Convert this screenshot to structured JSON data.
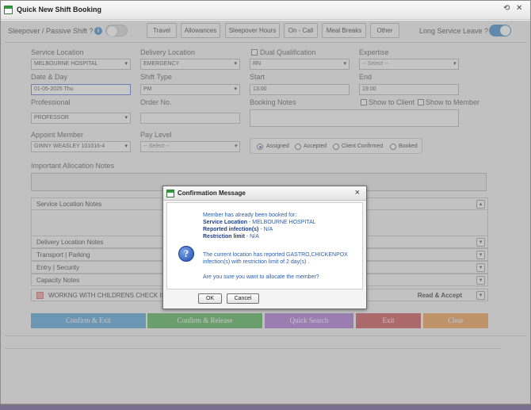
{
  "window": {
    "title": "Quick New Shift Booking"
  },
  "top_bar": {
    "sleepover_label": "Sleepover / Passive Shift ?",
    "tabs": [
      "Travel",
      "Allowances",
      "Sleepover Hours",
      "On - Call",
      "Meal Breaks",
      "Other"
    ],
    "long_service_label": "Long Service Leave ?",
    "sleepover_on": false,
    "long_service_on": true
  },
  "form": {
    "service_location": {
      "label": "Service Location",
      "value": "MELBOURNE HOSPITAL"
    },
    "delivery_location": {
      "label": "Delivery Location",
      "value": "EMERGENCY"
    },
    "dual_qualification": {
      "label": "Dual Qualification",
      "value": "RN"
    },
    "expertise": {
      "label": "Expertise",
      "placeholder": "-- Select --"
    },
    "date_day": {
      "label": "Date & Day",
      "value": "01-05-2025 Thu"
    },
    "shift_type": {
      "label": "Shift Type",
      "value": "PM"
    },
    "start": {
      "label": "Start",
      "value": "13:00"
    },
    "end": {
      "label": "End",
      "value": "19:00"
    },
    "professional": {
      "label": "Professional",
      "value": "PROFESSOR"
    },
    "order_no": {
      "label": "Order No.",
      "value": ""
    },
    "booking_notes": {
      "label": "Booking Notes"
    },
    "show_to_client": "Show to Client",
    "show_to_member": "Show to Member",
    "appoint_member": {
      "label": "Appoint Member",
      "value": "GINNY WEASLEY 101016-4"
    },
    "pay_level": {
      "label": "Pay Level",
      "placeholder": "-- Select --"
    },
    "status_options": [
      "Assigned",
      "Accepted",
      "Client Confirmed",
      "Booked"
    ],
    "status_selected": "Assigned",
    "allocation_notes_label": "Important Allocation Notes"
  },
  "sections": {
    "service_location_notes": "Service Location Notes",
    "delivery_location_notes": "Delivery Location Notes",
    "transport_parking": "Transport | Parking",
    "entry_security": "Entry | Security",
    "capacity_notes": "Capacity Notes",
    "wwc_label": "WORKNG WITH CHILDRENS CHECK IS F",
    "read_accept": "Read & Accept"
  },
  "actions": {
    "confirm_exit": "Confirm & Exit",
    "confirm_release": "Confirm & Release",
    "quick_search": "Quick Search",
    "exit": "Exit",
    "clear": "Clear"
  },
  "colors": {
    "confirm_exit": "#4d9fd8",
    "confirm_release": "#4caf50",
    "quick_search": "#a86fd3",
    "exit": "#c9494e",
    "clear": "#eb9a49",
    "toggle_on": "#3a86c8"
  },
  "dialog": {
    "title": "Confirmation Message",
    "line1": "Member has already been booked for:",
    "service_location_key": "Service Location",
    "service_location_val": " - MELBOURNE HOSPITAL",
    "reported_key": "Reported infection(s)",
    "reported_val": " - N/A",
    "restriction_key": "Restriction limit",
    "restriction_val": " - N/A",
    "current_line1": "The current location has reported GASTRO,CHICKENPOX",
    "current_line2": "infection(s) with restriction limit of 2 day(s) .",
    "question": "Are you sure you want to allocate the member?",
    "ok": "OK",
    "cancel": "Cancel"
  }
}
